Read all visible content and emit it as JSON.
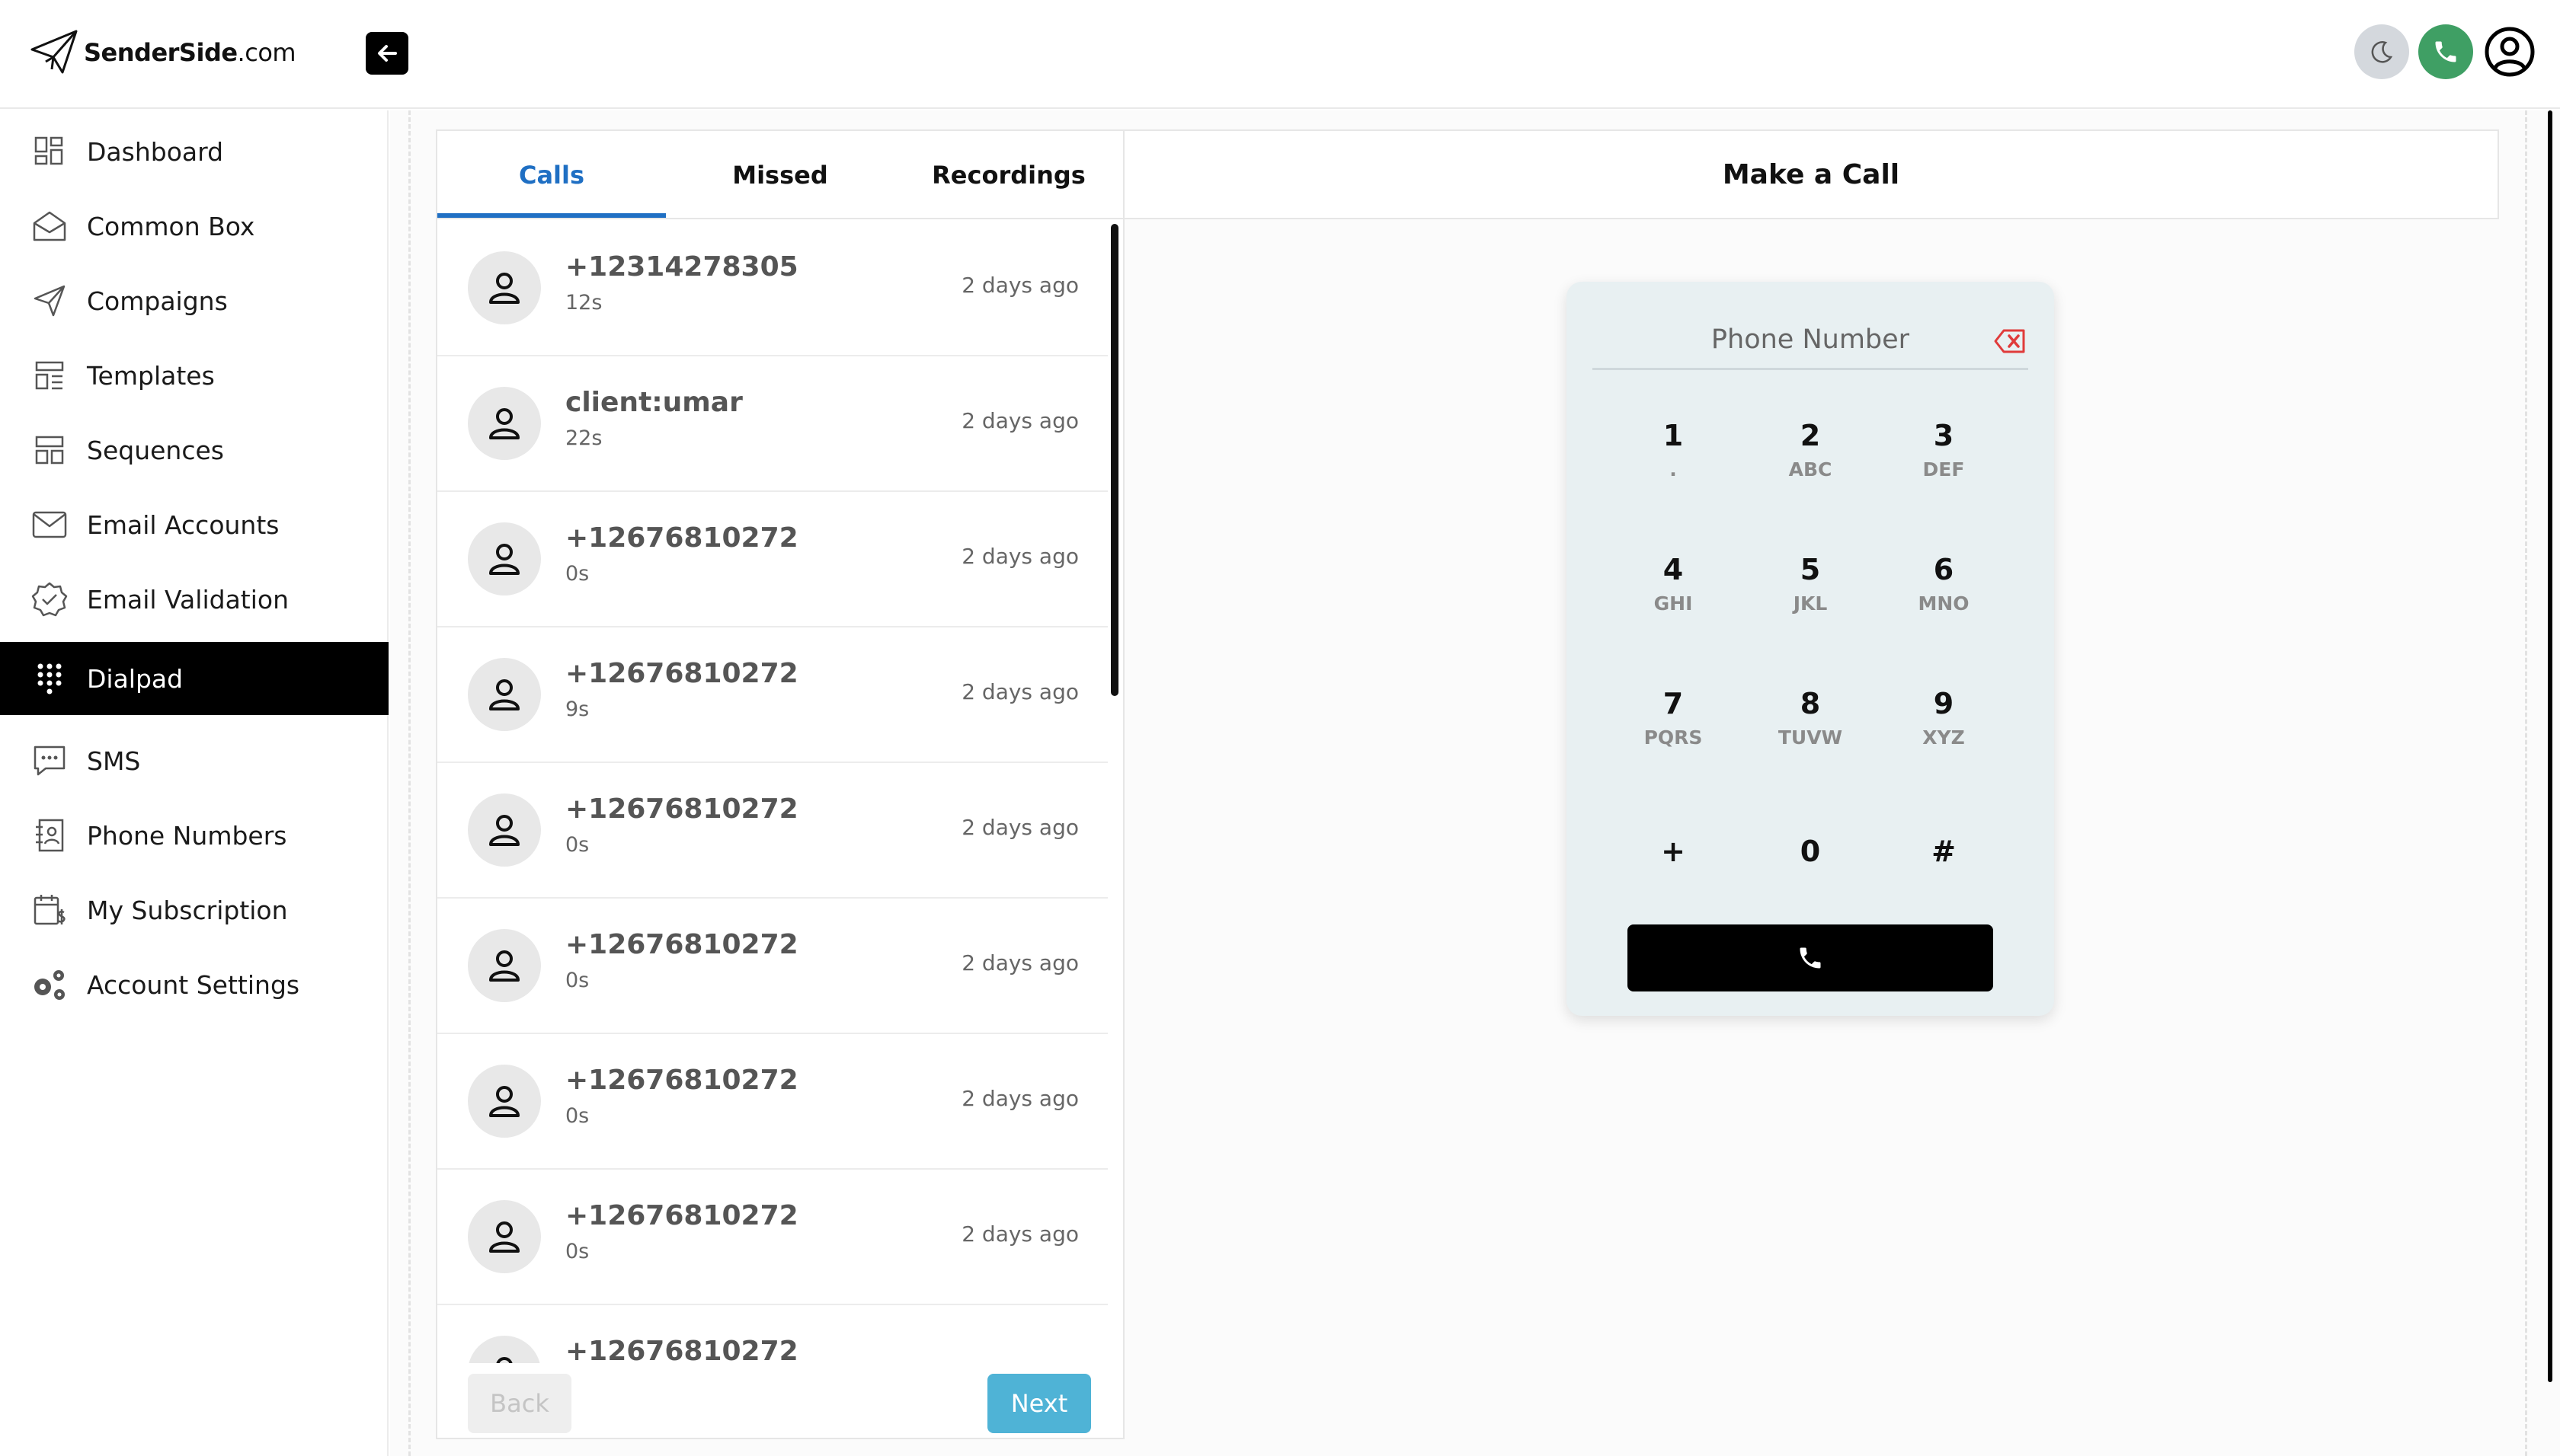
{
  "brand": {
    "name_bold": "SenderSide",
    "name_light": ".com"
  },
  "sidebar": {
    "items": [
      {
        "label": "Dashboard",
        "icon": "dashboard-icon"
      },
      {
        "label": "Common Box",
        "icon": "inbox-icon"
      },
      {
        "label": "Compaigns",
        "icon": "send-icon"
      },
      {
        "label": "Templates",
        "icon": "templates-icon"
      },
      {
        "label": "Sequences",
        "icon": "sequences-icon"
      },
      {
        "label": "Email Accounts",
        "icon": "mail-icon"
      },
      {
        "label": "Email Validation",
        "icon": "badge-check-icon"
      },
      {
        "label": "Dialpad",
        "icon": "dialpad-icon",
        "active": true
      },
      {
        "label": "SMS",
        "icon": "sms-icon"
      },
      {
        "label": "Phone Numbers",
        "icon": "contacts-icon"
      },
      {
        "label": "My Subscription",
        "icon": "subscription-icon"
      },
      {
        "label": "Account Settings",
        "icon": "gears-icon"
      }
    ]
  },
  "tabs": [
    "Calls",
    "Missed",
    "Recordings"
  ],
  "calls": [
    {
      "number": "+12314278305",
      "duration": "12s",
      "time": "2 days ago"
    },
    {
      "number": "client:umar",
      "duration": "22s",
      "time": "2 days ago"
    },
    {
      "number": "+12676810272",
      "duration": "0s",
      "time": "2 days ago"
    },
    {
      "number": "+12676810272",
      "duration": "9s",
      "time": "2 days ago"
    },
    {
      "number": "+12676810272",
      "duration": "0s",
      "time": "2 days ago"
    },
    {
      "number": "+12676810272",
      "duration": "0s",
      "time": "2 days ago"
    },
    {
      "number": "+12676810272",
      "duration": "0s",
      "time": "2 days ago"
    },
    {
      "number": "+12676810272",
      "duration": "0s",
      "time": "2 days ago"
    },
    {
      "number": "+12676810272",
      "duration": "",
      "time": ""
    }
  ],
  "pagination": {
    "back": "Back",
    "next": "Next"
  },
  "make_call": {
    "title": "Make a Call",
    "placeholder": "Phone Number",
    "keys": [
      {
        "num": "1",
        "sub": "."
      },
      {
        "num": "2",
        "sub": "ABC"
      },
      {
        "num": "3",
        "sub": "DEF"
      },
      {
        "num": "4",
        "sub": "GHI"
      },
      {
        "num": "5",
        "sub": "JKL"
      },
      {
        "num": "6",
        "sub": "MNO"
      },
      {
        "num": "7",
        "sub": "PQRS"
      },
      {
        "num": "8",
        "sub": "TUVW"
      },
      {
        "num": "9",
        "sub": "XYZ"
      },
      {
        "num": "+",
        "sub": ""
      },
      {
        "num": "0",
        "sub": ""
      },
      {
        "num": "#",
        "sub": ""
      }
    ]
  },
  "colors": {
    "accent": "#1f6fc3",
    "next_button": "#4fb3d6",
    "phone_button": "#3f9f64",
    "backspace": "#e03b3b"
  }
}
